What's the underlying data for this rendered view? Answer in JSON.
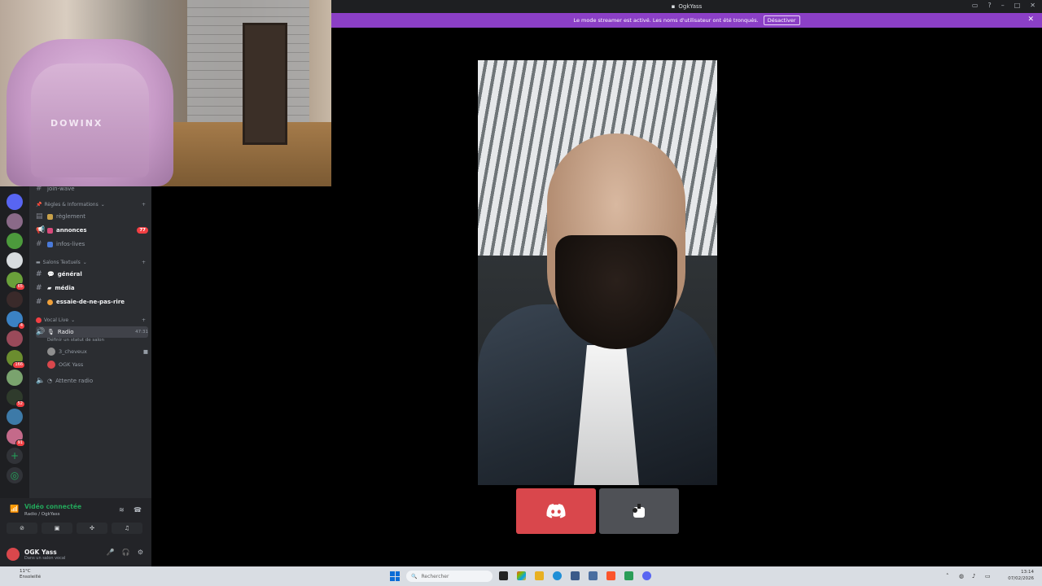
{
  "window": {
    "title": "OgkYass"
  },
  "banner": {
    "message": "Le mode streamer est activé. Les noms d'utilisateur ont été tronqués.",
    "button": "Désactiver",
    "close": "✕"
  },
  "webcam": {
    "chair_brand": "DOWINX"
  },
  "rail": {
    "servers": [
      {
        "color": "#5865f2",
        "badge": ""
      },
      {
        "color": "#8a6a88",
        "badge": ""
      },
      {
        "color": "#4c9a3c",
        "badge": ""
      },
      {
        "color": "#d8dcdf",
        "badge": ""
      },
      {
        "color": "#6aa03a",
        "badge": "65"
      },
      {
        "color": "#3a2a2a",
        "badge": ""
      },
      {
        "color": "#3b82c4",
        "badge": "4"
      },
      {
        "color": "#9a4a5a",
        "badge": ""
      },
      {
        "color": "#6b8d2f",
        "badge": "166"
      },
      {
        "color": "#7aa36e",
        "badge": ""
      },
      {
        "color": "#2f3b2c",
        "badge": "52"
      },
      {
        "color": "#3d7aa8",
        "badge": ""
      },
      {
        "color": "#c46a8a",
        "badge": "91"
      }
    ]
  },
  "channels": {
    "top_partial": "join-wave",
    "categories": {
      "rules": "Règles & Informations",
      "text": "Salons Textuels",
      "voice": "Vocal Live"
    },
    "rules_items": [
      {
        "label": "règlement",
        "bold": false
      },
      {
        "label": "annonces",
        "bold": true,
        "mention": "77"
      },
      {
        "label": "infos-lives",
        "bold": false
      }
    ],
    "text_items": [
      {
        "label": "général"
      },
      {
        "label": "média"
      },
      {
        "label": "essaie-de-ne-pas-rire"
      }
    ],
    "voice_items": {
      "radio": "Radio",
      "radio_timer": "47:31",
      "radio_status": "Définir un statut de salon",
      "members": [
        "3_cheveux",
        "OGK Yass"
      ],
      "attente": "Attente radio"
    }
  },
  "voice_panel": {
    "status": "Vidéo connectée",
    "location": "Radio / OgkYass"
  },
  "user": {
    "name": "OGK Yass",
    "status": "Dans un salon vocal"
  },
  "taskbar": {
    "weather_temp": "11°C",
    "weather_desc": "Ensoleillé",
    "search_placeholder": "Rechercher",
    "time": "13:14",
    "date": "07/02/2026"
  },
  "colors": {
    "discord_red": "#d9474c",
    "streamer_purple": "#8b3fc6",
    "voice_green": "#23a55a"
  }
}
